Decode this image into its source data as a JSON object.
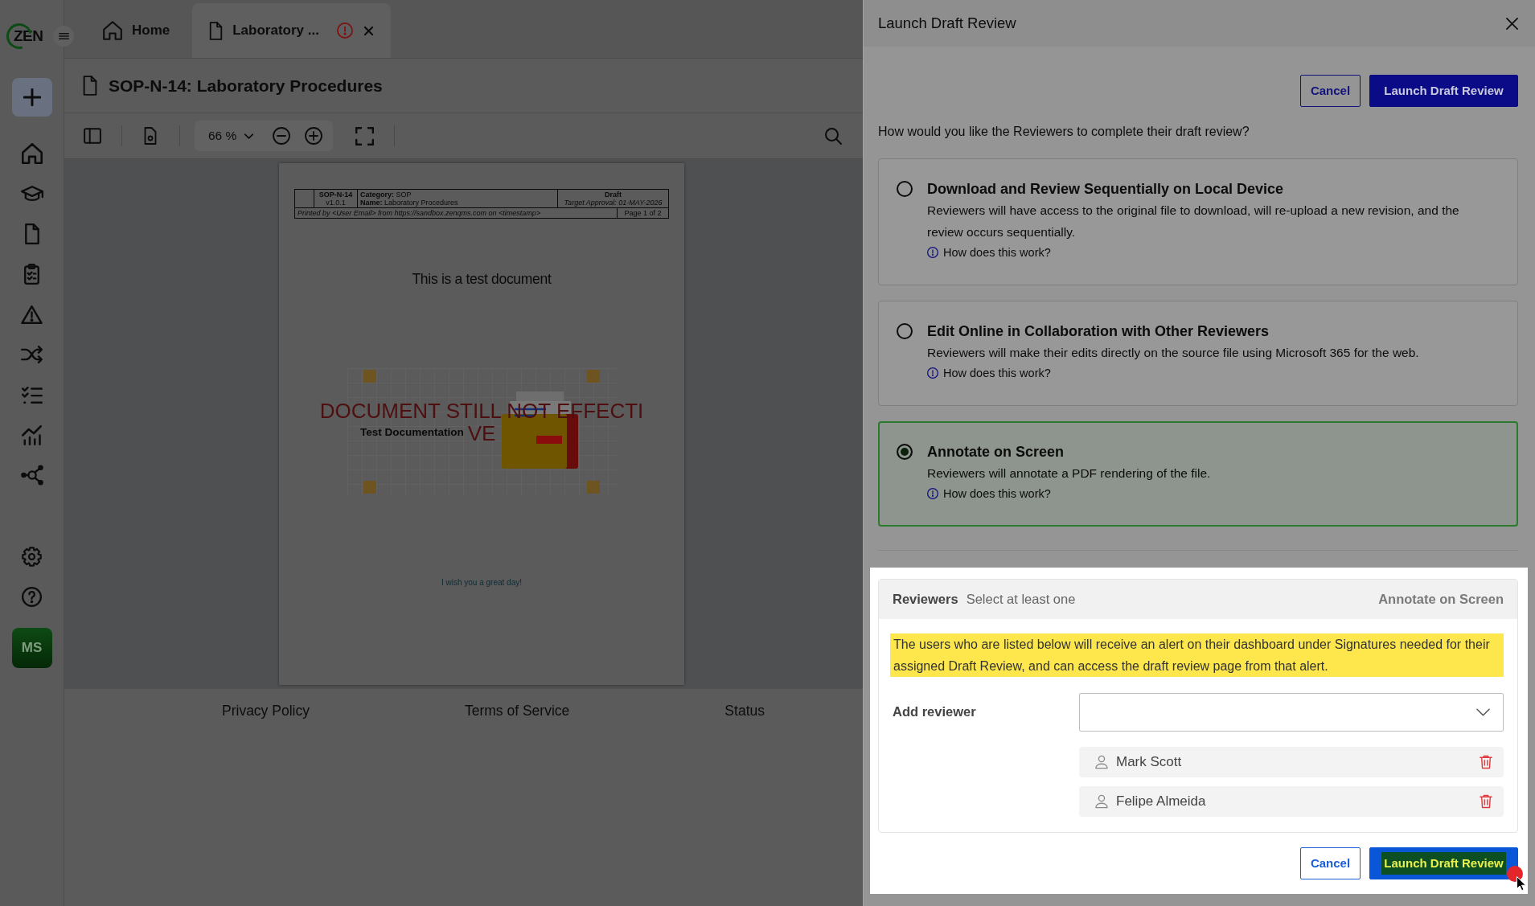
{
  "app": {
    "logo": "ZEN",
    "user_initials": "MS"
  },
  "tabs": [
    {
      "label": "Home",
      "kind": "home",
      "selected": false,
      "alert": false,
      "closable": false
    },
    {
      "label": "Laboratory ...",
      "kind": "document",
      "selected": true,
      "alert": true,
      "closable": true
    }
  ],
  "document": {
    "title": "SOP-N-14: Laboratory Procedures",
    "zoom": "66 %",
    "page": {
      "header": {
        "number": "SOP-N-14",
        "version": "v1.0.1",
        "category": "**Category:** SOP",
        "name": "**Name:** Laboratory Procedures",
        "status": "Draft",
        "target": "Target Approval: 01-MAY-2026",
        "printed": "Printed by <User Email> from https://sandbox.zenqms.com on <timestamp>",
        "page": "Page 1 of 2"
      },
      "heading": "This is a test document",
      "watermark": [
        "DOCUMENT STILL NOT EFFECTI",
        "VE"
      ],
      "image_caption": "Test Documentation",
      "closing": "I wish you a great day!"
    }
  },
  "footer": {
    "links": [
      "Privacy Policy",
      "Terms of Service",
      "Status"
    ]
  },
  "panel": {
    "title": "Launch Draft Review",
    "top_actions": [
      {
        "label": "Cancel",
        "kind": "cancel",
        "highlighted": false
      },
      {
        "label": "Launch Draft Review",
        "kind": "launch",
        "highlighted": false
      }
    ],
    "question": "How would you like the Reviewers to complete their draft review?",
    "options": [
      {
        "title": "Download and Review Sequentially on Local Device",
        "description": "Reviewers will have access to the original file to download, will re-upload a new revision, and the review occurs sequentially.",
        "help": "How does this work?",
        "selected": false
      },
      {
        "title": "Edit Online in Collaboration with Other Reviewers",
        "description": "Reviewers will make their edits directly on the source file using Microsoft 365 for the web.",
        "help": "How does this work?",
        "selected": false
      },
      {
        "title": "Annotate on Screen",
        "description": "Reviewers will annotate a PDF rendering of the file.",
        "help": "How does this work?",
        "selected": true
      }
    ],
    "reviewers": {
      "title": "Reviewers",
      "hint": "Select at least one",
      "mode": "Annotate on Screen",
      "notice": "The users who are listed below will receive an alert on their dashboard under Signatures needed for their assigned Draft Review, and can access the draft review page from that alert.",
      "add_label": "Add reviewer",
      "people": [
        {
          "name": "Mark Scott"
        },
        {
          "name": "Felipe Almeida"
        }
      ]
    },
    "bottom_actions": [
      {
        "label": "Cancel",
        "kind": "cancel",
        "highlighted": false
      },
      {
        "label": "Launch Draft Review",
        "kind": "launch",
        "highlighted": true
      }
    ]
  }
}
